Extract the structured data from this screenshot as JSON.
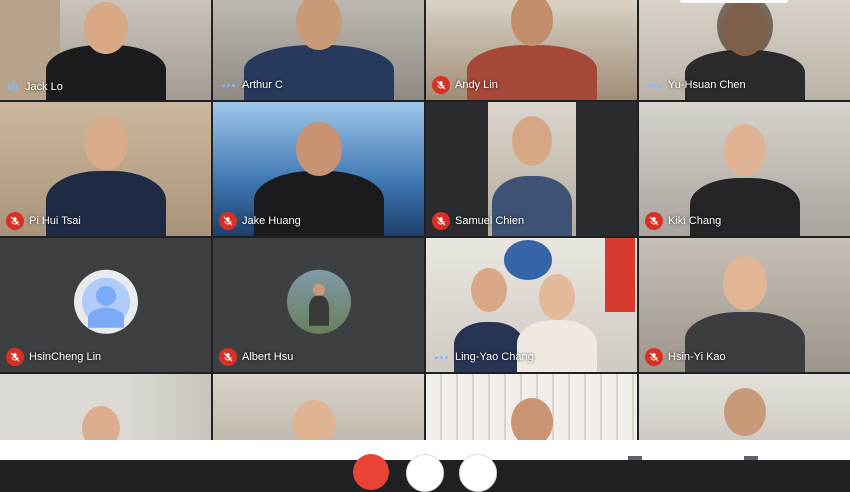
{
  "participants": [
    {
      "name": "Jack Lo",
      "status": "speaking"
    },
    {
      "name": "Arthur C",
      "status": "active"
    },
    {
      "name": "Andy Lin",
      "status": "muted"
    },
    {
      "name": "Yu-Hsuan Chen",
      "status": "active"
    },
    {
      "name": "Pi Hui Tsai",
      "status": "muted"
    },
    {
      "name": "Jake Huang",
      "status": "muted"
    },
    {
      "name": "Samuel Chien",
      "status": "muted"
    },
    {
      "name": "Kiki Chang",
      "status": "muted"
    },
    {
      "name": "HsinCheng Lin",
      "status": "muted"
    },
    {
      "name": "Albert Hsu",
      "status": "muted"
    },
    {
      "name": "Ling-Yao Chang",
      "status": "active"
    },
    {
      "name": "Hsin-Yi Kao",
      "status": "muted"
    }
  ],
  "colors": {
    "mic_off": "#d93025",
    "speaking_outline": "#7fc8ce",
    "active_indicator": "#8ab4f8",
    "end_call": "#ea4335"
  }
}
